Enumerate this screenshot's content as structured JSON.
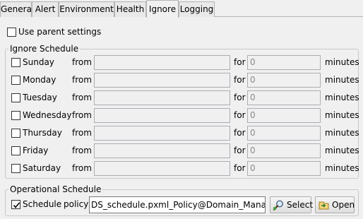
{
  "tabs": [
    {
      "label": "General",
      "active": false
    },
    {
      "label": "Alert",
      "active": false
    },
    {
      "label": "Environment",
      "active": false
    },
    {
      "label": "Health",
      "active": false
    },
    {
      "label": "Ignore",
      "active": true
    },
    {
      "label": "Logging",
      "active": false
    }
  ],
  "use_parent": {
    "label": "Use parent settings",
    "checked": false
  },
  "ignore_schedule": {
    "legend": "Ignore Schedule",
    "from_label": "from",
    "for_label": "for",
    "minutes_label": "minutes",
    "days": [
      {
        "name": "Sunday",
        "checked": false,
        "from": "",
        "minutes": "0"
      },
      {
        "name": "Monday",
        "checked": false,
        "from": "",
        "minutes": "0"
      },
      {
        "name": "Tuesday",
        "checked": false,
        "from": "",
        "minutes": "0"
      },
      {
        "name": "Wednesday",
        "checked": false,
        "from": "",
        "minutes": "0"
      },
      {
        "name": "Thursday",
        "checked": false,
        "from": "",
        "minutes": "0"
      },
      {
        "name": "Friday",
        "checked": false,
        "from": "",
        "minutes": "0"
      },
      {
        "name": "Saturday",
        "checked": false,
        "from": "",
        "minutes": "0"
      }
    ]
  },
  "operational_schedule": {
    "legend": "Operational Schedule",
    "schedule_label": "Schedule",
    "schedule_checked": true,
    "policy_label": "policy",
    "policy_value": "DS_schedule.pxml_Policy@Domain_Manager",
    "select_label": "Select",
    "open_label": "Open",
    "select_icon": "magnifier-icon",
    "open_icon": "open-icon"
  }
}
